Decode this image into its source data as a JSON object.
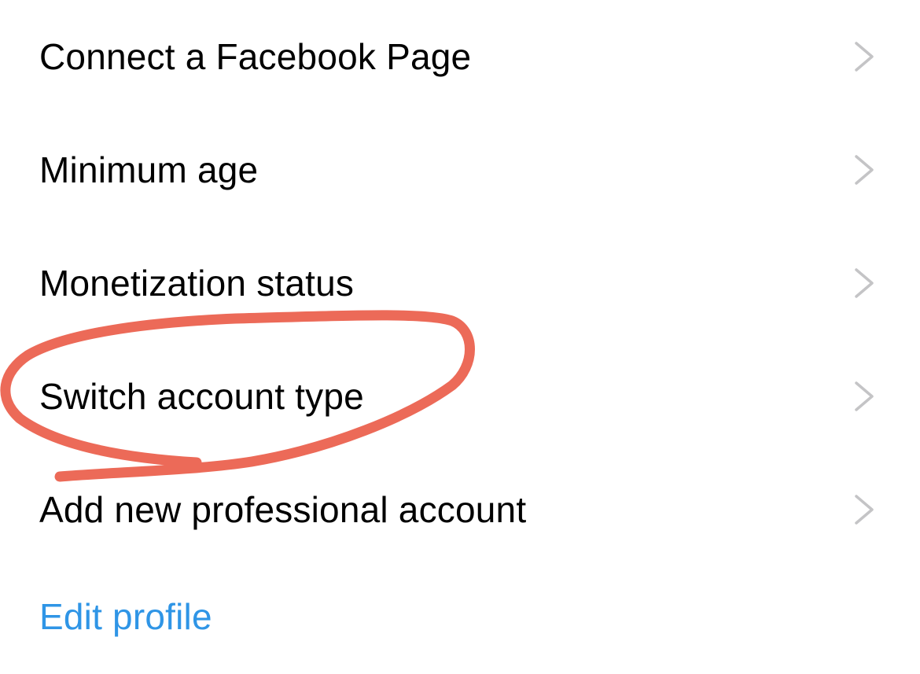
{
  "menu": {
    "items": [
      {
        "label": "Connect a Facebook Page"
      },
      {
        "label": "Minimum age"
      },
      {
        "label": "Monetization status"
      },
      {
        "label": "Switch account type"
      },
      {
        "label": "Add new professional account"
      }
    ],
    "edit_profile_link": "Edit profile",
    "chevron_icon": "chevron-right-icon"
  },
  "colors": {
    "text": "#000000",
    "link": "#2f95e6",
    "chevron": "#c4c4c6",
    "annotation": "#ec6a58"
  },
  "annotation": {
    "type": "hand-drawn circle",
    "target": "Switch account type"
  }
}
